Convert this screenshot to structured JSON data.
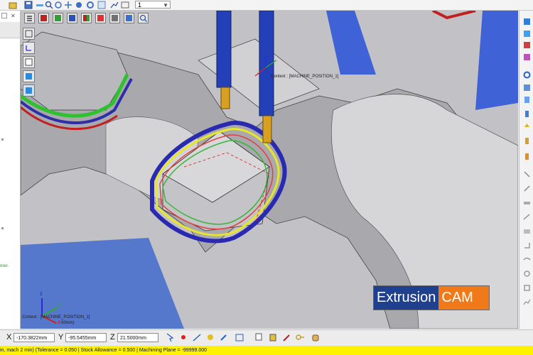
{
  "toolbar": {
    "layer_select_value": "1"
  },
  "left_panel": {
    "notes": [
      "rner."
    ]
  },
  "viewport": {
    "context_label_bottom": "Context : [MACHINE_POSITION_1]",
    "context_label_tool": "Context : [MACHINE_POSITION_1]",
    "triad_partial_label": "00mm)",
    "axis_labels": {
      "x": "X",
      "y": "Y",
      "z": "Z"
    }
  },
  "logo": {
    "part1": "Extrusion",
    "part2": "CAM",
    "colors": {
      "part1_bg": "#1f3f8f",
      "part2_bg": "#f07a1a"
    }
  },
  "coordinates": {
    "x_label": "X",
    "x_value": "-170.3822mm",
    "y_label": "Y",
    "y_value": "-95.5455mm",
    "z_label": "Z",
    "z_value": "21.5000mm"
  },
  "status": {
    "text": "in, mach 2 min) (Tolerance = 0.050 | Stock Allowance = 0.500 | Machining Plane = -99999.000"
  },
  "icons": {
    "top_toolbar": [
      "file-open-icon",
      "save-icon",
      "measure-icon",
      "zoom-icon",
      "rotate-icon",
      "pan-icon",
      "view-icon",
      "settings-icon",
      "chart-icon",
      "graph-icon",
      "layer-icon"
    ],
    "view_toolbar": [
      "menu-icon",
      "cube-red-icon",
      "cube-green-icon",
      "cube-blue-icon",
      "cube-multi-icon",
      "cube-red2-icon",
      "cube-gray-icon",
      "cube-blue2-icon",
      "zoom-fit-icon"
    ],
    "left_view_toolbar": [
      "wireframe-cube-icon",
      "axis-icon",
      "outline-cube-icon",
      "solid-cube-icon",
      "selected-cube-icon"
    ],
    "right_toolbar": [
      "cube-view-icon",
      "cube-plus-icon",
      "cube-red-icon",
      "cube-color-icon",
      "gear-icon",
      "cube-small-icon",
      "tool-icon",
      "cylinder-icon",
      "arrow-up-icon",
      "toolpath-icon",
      "drill-icon",
      "mill-icon",
      "cut-icon",
      "layer-icon",
      "edge-icon",
      "surface-icon",
      "angle-icon",
      "sweep-icon",
      "gear-small-icon",
      "settings-icon",
      "chart-icon"
    ],
    "coord_tools": [
      "select-icon",
      "point-icon",
      "pick-icon",
      "snap-icon",
      "edit-icon",
      "table-icon",
      "copy-icon",
      "paste-icon",
      "pen-icon",
      "key-icon"
    ]
  }
}
